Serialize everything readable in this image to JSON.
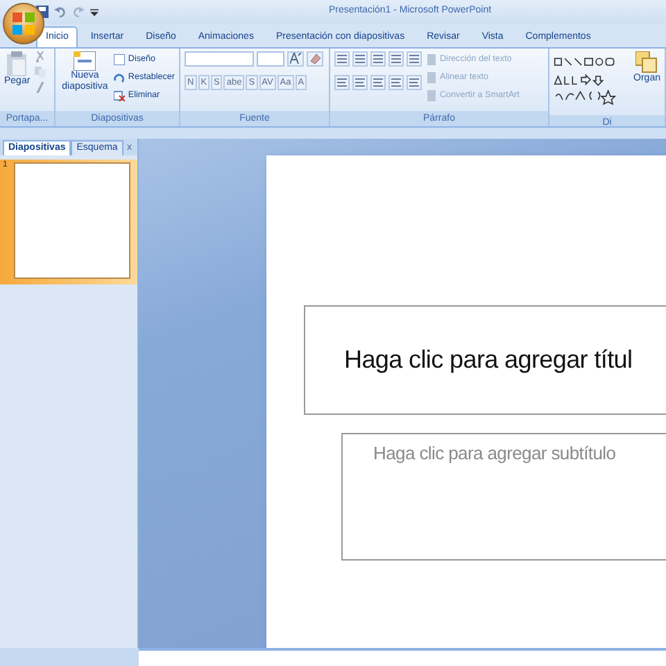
{
  "window": {
    "title": "Presentación1 - Microsoft PowerPoint"
  },
  "tabs": [
    {
      "label": "Inicio",
      "selected": true
    },
    {
      "label": "Insertar",
      "selected": false
    },
    {
      "label": "Diseño",
      "selected": false
    },
    {
      "label": "Animaciones",
      "selected": false
    },
    {
      "label": "Presentación con diapositivas",
      "selected": false
    },
    {
      "label": "Revisar",
      "selected": false
    },
    {
      "label": "Vista",
      "selected": false
    },
    {
      "label": "Complementos",
      "selected": false
    }
  ],
  "ribbon": {
    "groups": [
      {
        "kind": "clipboard",
        "label": "Portapa...",
        "big": "Pegar"
      },
      {
        "kind": "slides",
        "label": "Diapositivas",
        "big": "Nueva diapositiva",
        "items": [
          "Diseño",
          "Restablecer",
          "Eliminar"
        ]
      },
      {
        "kind": "font",
        "label": "Fuente",
        "format_buttons": [
          "N",
          "K",
          "S",
          "abe",
          "S",
          "AV",
          "Aa",
          "A"
        ]
      },
      {
        "kind": "paragraph",
        "label": "Párrafo",
        "items": [
          {
            "label": "Dirección del texto",
            "disabled": true
          },
          {
            "label": "Alinear texto",
            "disabled": true
          },
          {
            "label": "Convertir a SmartArt",
            "disabled": true
          }
        ]
      },
      {
        "kind": "drawing",
        "label": "Di",
        "big": "Organ"
      }
    ]
  },
  "panel": {
    "tabs": [
      {
        "label": "Diapositivas",
        "selected": true
      },
      {
        "label": "Esquema",
        "selected": false
      }
    ],
    "close": "x",
    "slides": [
      {
        "number": "1",
        "selected": true
      }
    ]
  },
  "slide": {
    "title_placeholder": "Haga clic para agregar títul",
    "subtitle_placeholder": "Haga clic para agregar subtítulo"
  }
}
